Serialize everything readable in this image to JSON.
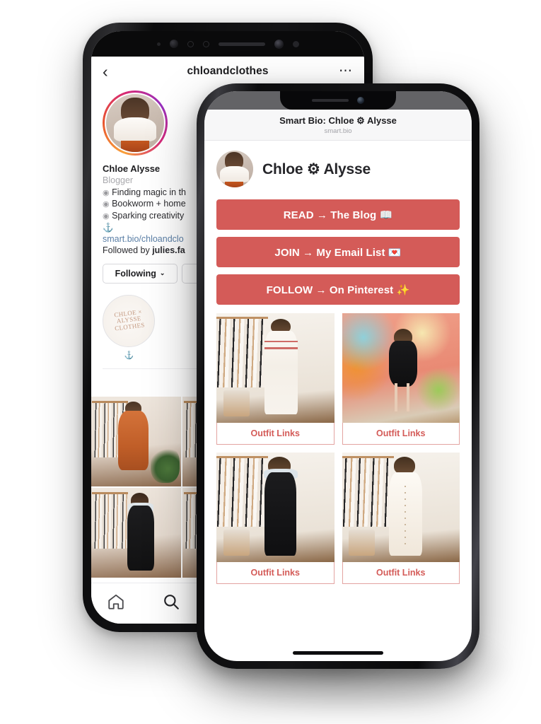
{
  "theme": {
    "accent_red": "#d45b58",
    "outfit_link_border": "#e3a3a1",
    "outfit_link_text": "#d45b58",
    "page_background": "#ffffff"
  },
  "instagram_phone": {
    "nav": {
      "back_icon": "chevron-left-icon",
      "username": "chloandclothes",
      "more_icon": "ellipsis-icon"
    },
    "profile": {
      "avatar_label": "chloandclothes profile photo",
      "display_name": "Chloe Alysse",
      "category": "Blogger",
      "bio_lines": [
        "Finding magic in th",
        "Bookworm + home",
        "Sparking creativity"
      ],
      "bio_bullet": "◉",
      "bio_glyph": "⚓",
      "website": "smart.bio/chloandclo",
      "followed_by_prefix": "Followed by ",
      "followed_by_name": "julies.fa"
    },
    "actions": [
      {
        "label": "Following",
        "chevron": "⌄"
      },
      {
        "label": ""
      }
    ],
    "highlight": {
      "logo_lines": [
        "CHLOE ×",
        "ALYSSE",
        "CLOTHES"
      ],
      "label": "⚓"
    },
    "tabs": [
      {
        "icon": "grid-icon",
        "selected": true
      }
    ],
    "grid_photos": [
      "rust-dress-clothing-rack",
      "orange-midi-dress-plant",
      "white-wall-outfit",
      "clothing-rack-white",
      "black-pinafore-dress",
      "white-door-outfit"
    ],
    "tabbar": [
      {
        "icon": "home-icon"
      },
      {
        "icon": "search-icon"
      }
    ]
  },
  "smartbio_phone": {
    "header": {
      "title": "Smart Bio: Chloe ⚙ Alysse",
      "url": "smart.bio"
    },
    "profile": {
      "avatar_label": "Chloe Alysse avatar",
      "name": "Chloe ⚙ Alysse"
    },
    "cta_buttons": [
      {
        "label": "READ → The Blog 📖"
      },
      {
        "label": "JOIN → My Email List 💌"
      },
      {
        "label": "FOLLOW → On Pinterest ✨"
      }
    ],
    "outfit_cards": [
      {
        "image": "white-striped-set-clothing-rack",
        "button_label": "Outfit Links"
      },
      {
        "image": "black-dress-colorful-mural-wall",
        "button_label": "Outfit Links"
      },
      {
        "image": "black-pinafore-dress-clothing-rack",
        "button_label": "Outfit Links"
      },
      {
        "image": "cream-button-dress-clothing-rack",
        "button_label": "Outfit Links"
      }
    ]
  }
}
